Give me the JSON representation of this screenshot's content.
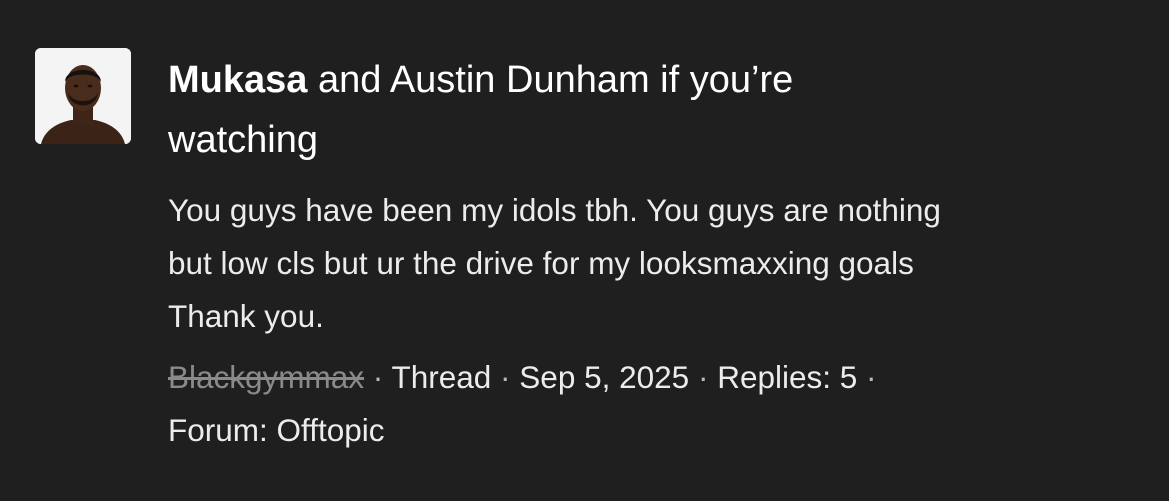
{
  "result": {
    "title_highlight": "Mukasa",
    "title_rest_line1": " and Austin Dunham if you’re",
    "title_line2": "watching",
    "snippet_lines": [
      "You guys have been my idols tbh. You guys are nothing",
      "but low cls but ur the drive for my looksmaxxing goals",
      "Thank you."
    ],
    "author": "Blackgymmax",
    "separator": " · ",
    "content_type": "Thread",
    "date": "Sep 5, 2025",
    "replies": "Replies: 5",
    "forum": "Forum: Offtopic",
    "avatar_icon": "user-avatar-photo",
    "colors": {
      "background": "#1f1f1f",
      "text": "#ececec",
      "author_struck": "#8a8a8a"
    }
  }
}
